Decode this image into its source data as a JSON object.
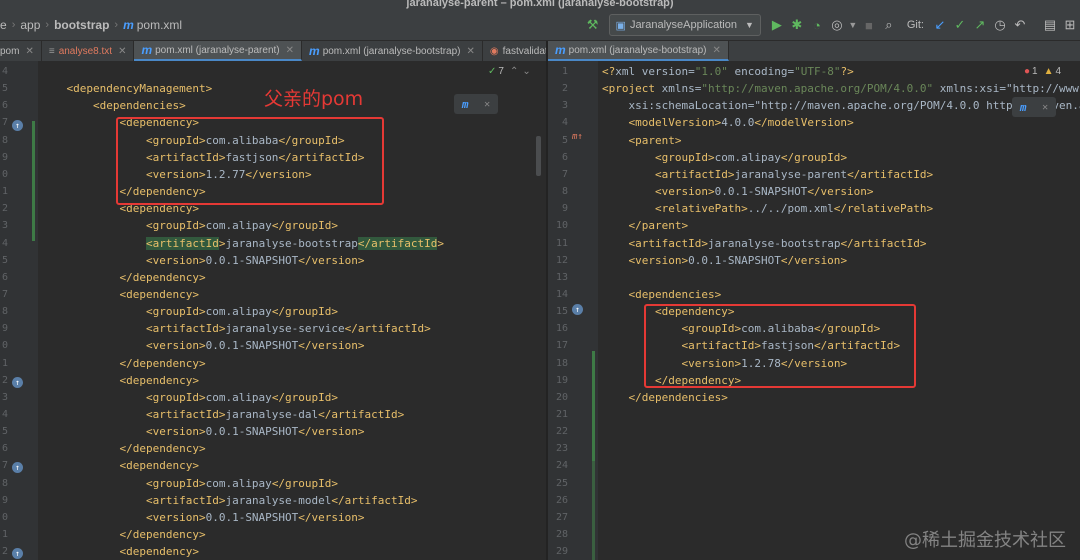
{
  "window": {
    "title": "jaranalyse-parent – pom.xml (jaranalyse-bootstrap)"
  },
  "breadcrumb": {
    "items": [
      "e",
      "app",
      "bootstrap",
      "pom.xml"
    ]
  },
  "toolbar": {
    "run_config": "JaranalyseApplication",
    "vcs_label": "Git:"
  },
  "tabs_left": [
    "pom",
    "analyse8.txt",
    "pom.xml (jaranalyse-parent)",
    "pom.xml (jaranalyse-bootstrap)",
    "fastvalidat"
  ],
  "tabs_right": [
    "pom.xml (jaranalyse-bootstrap)"
  ],
  "left_editor": {
    "inspection_count": "7",
    "annotation": "父亲的pom",
    "line_numbers": [
      "4",
      "5",
      "6",
      "7",
      "8",
      "9",
      "0",
      "1",
      "2",
      "3",
      "4",
      "5",
      "6",
      "7",
      "8",
      "9",
      "0",
      "1",
      "2",
      "3",
      "4",
      "5",
      "6",
      "7",
      "8",
      "9",
      "0",
      "1",
      "2",
      "3"
    ],
    "lines": [
      "",
      "    <dependencyManagement>",
      "        <dependencies>",
      "            <dependency>",
      "                <groupId>com.alibaba</groupId>",
      "                <artifactId>fastjson</artifactId>",
      "                <version>1.2.77</version>",
      "            </dependency>",
      "            <dependency>",
      "                <groupId>com.alipay</groupId>",
      "                <artifactId>jaranalyse-bootstrap</artifactId>",
      "                <version>0.0.1-SNAPSHOT</version>",
      "            </dependency>",
      "            <dependency>",
      "                <groupId>com.alipay</groupId>",
      "                <artifactId>jaranalyse-service</artifactId>",
      "                <version>0.0.1-SNAPSHOT</version>",
      "            </dependency>",
      "            <dependency>",
      "                <groupId>com.alipay</groupId>",
      "                <artifactId>jaranalyse-dal</artifactId>",
      "                <version>0.0.1-SNAPSHOT</version>",
      "            </dependency>",
      "            <dependency>",
      "                <groupId>com.alipay</groupId>",
      "                <artifactId>jaranalyse-model</artifactId>",
      "                <version>0.0.1-SNAPSHOT</version>",
      "            </dependency>",
      "            <dependency>"
    ]
  },
  "right_editor": {
    "error_count": "1",
    "warning_count": "4",
    "line_numbers": [
      "1",
      "2",
      "3",
      "4",
      "5",
      "6",
      "7",
      "8",
      "9",
      "10",
      "11",
      "12",
      "13",
      "14",
      "15",
      "16",
      "17",
      "18",
      "19",
      "20",
      "21",
      "22",
      "23",
      "24",
      "25",
      "26",
      "27",
      "28",
      "29"
    ],
    "lines": [
      "<?xml version=\"1.0\" encoding=\"UTF-8\"?>",
      "<project xmlns=\"http://maven.apache.org/POM/4.0.0\" xmlns:xsi=\"http://www.",
      "    xsi:schemaLocation=\"http://maven.apache.org/POM/4.0.0 https://maven.a",
      "    <modelVersion>4.0.0</modelVersion>",
      "    <parent>",
      "        <groupId>com.alipay</groupId>",
      "        <artifactId>jaranalyse-parent</artifactId>",
      "        <version>0.0.1-SNAPSHOT</version>",
      "        <relativePath>../../pom.xml</relativePath>",
      "    </parent>",
      "    <artifactId>jaranalyse-bootstrap</artifactId>",
      "    <version>0.0.1-SNAPSHOT</version>",
      "",
      "    <dependencies>",
      "        <dependency>",
      "            <groupId>com.alibaba</groupId>",
      "            <artifactId>fastjson</artifactId>",
      "            <version>1.2.78</version>",
      "        </dependency>",
      "    </dependencies>"
    ]
  },
  "watermark": "@稀土掘金技术社区",
  "colors": {
    "tag": "#e8bf6a",
    "string": "#6a8759",
    "text": "#a9b7c6",
    "highlight_box": "#e53935",
    "background": "#2b2b2b"
  }
}
